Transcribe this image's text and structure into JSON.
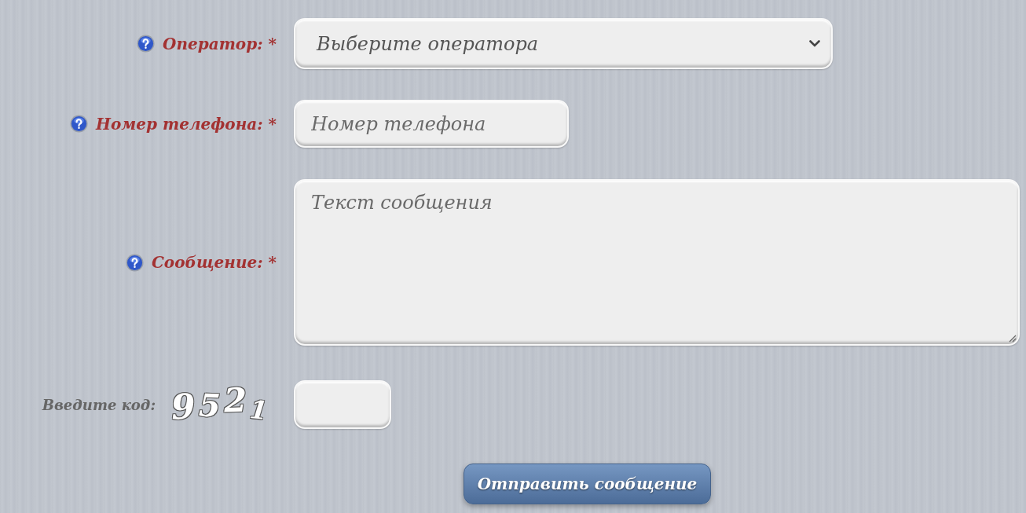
{
  "form": {
    "fields": [
      {
        "kind": "select",
        "label": "Оператор: *",
        "help": true,
        "value": "Выберите оператора"
      },
      {
        "kind": "text",
        "label": "Номер телефона: *",
        "help": true,
        "placeholder": "Номер телефона"
      },
      {
        "kind": "textarea",
        "label": "Сообщение: *",
        "help": true,
        "placeholder": "Текст сообщения"
      },
      {
        "kind": "captcha",
        "label": "Введите код:",
        "code": "9521"
      }
    ],
    "submit_button": "Отправить сообщение"
  }
}
